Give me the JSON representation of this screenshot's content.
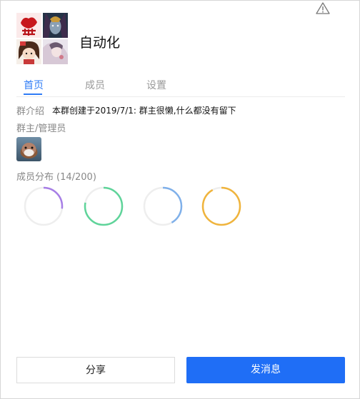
{
  "group": {
    "name": "自动化"
  },
  "tabs": [
    {
      "label": "首页",
      "active": true
    },
    {
      "label": "成员",
      "active": false
    },
    {
      "label": "设置",
      "active": false
    }
  ],
  "intro": {
    "label": "群介绍",
    "text": "本群创建于2019/7/1:  群主很懒,什么都没有留下"
  },
  "admins": {
    "label": "群主/管理员"
  },
  "distribution": {
    "label": "成员分布",
    "count": "(14/200)",
    "rings": [
      {
        "color": "#a77ee6",
        "fraction": 0.27
      },
      {
        "color": "#5fd49a",
        "fraction": 0.78
      },
      {
        "color": "#7fb0ea",
        "fraction": 0.42
      },
      {
        "color": "#f0b43c",
        "fraction": 0.92
      }
    ]
  },
  "buttons": {
    "share": "分享",
    "send": "发消息"
  },
  "icons": {
    "warning": "warning-triangle-icon"
  }
}
